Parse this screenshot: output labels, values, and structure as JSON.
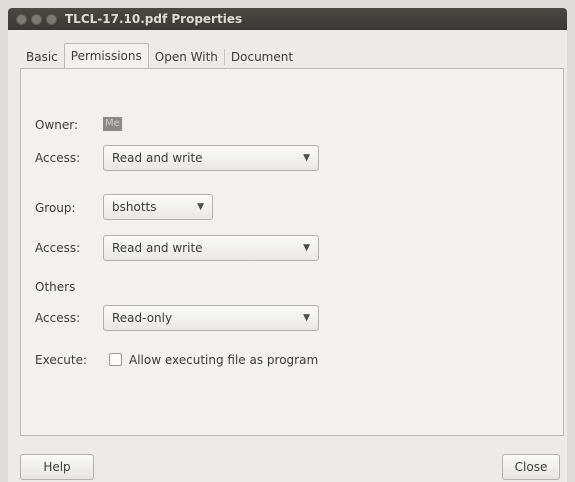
{
  "window": {
    "title": "TLCL-17.10.pdf Properties"
  },
  "tabs": [
    {
      "label": "Basic"
    },
    {
      "label": "Permissions"
    },
    {
      "label": "Open With"
    },
    {
      "label": "Document"
    }
  ],
  "permissions": {
    "owner_label": "Owner:",
    "owner_value": "Me",
    "owner_access_label": "Access:",
    "owner_access_value": "Read and write",
    "group_label": "Group:",
    "group_value": "bshotts",
    "group_access_label": "Access:",
    "group_access_value": "Read and write",
    "others_label": "Others",
    "others_access_label": "Access:",
    "others_access_value": "Read-only",
    "execute_label": "Execute:",
    "execute_checkbox_label": "Allow executing file as program"
  },
  "buttons": {
    "help": "Help",
    "close": "Close"
  }
}
